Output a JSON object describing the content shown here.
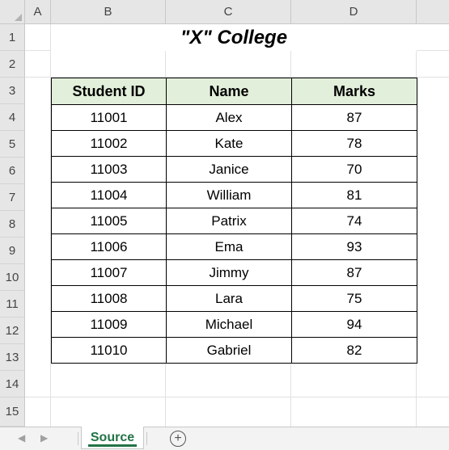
{
  "columns": [
    "A",
    "B",
    "C",
    "D"
  ],
  "rows": [
    "1",
    "2",
    "3",
    "4",
    "5",
    "6",
    "7",
    "8",
    "9",
    "10",
    "11",
    "12",
    "13",
    "14",
    "15"
  ],
  "sheet_title": "\"X\" College",
  "table": {
    "headers": [
      "Student ID",
      "Name",
      "Marks"
    ],
    "rows": [
      [
        "11001",
        "Alex",
        "87"
      ],
      [
        "11002",
        "Kate",
        "78"
      ],
      [
        "11003",
        "Janice",
        "70"
      ],
      [
        "11004",
        "William",
        "81"
      ],
      [
        "11005",
        "Patrix",
        "74"
      ],
      [
        "11006",
        "Ema",
        "93"
      ],
      [
        "11007",
        "Jimmy",
        "87"
      ],
      [
        "11008",
        "Lara",
        "75"
      ],
      [
        "11009",
        "Michael",
        "94"
      ],
      [
        "11010",
        "Gabriel",
        "82"
      ]
    ]
  },
  "tabs": {
    "active": "Source",
    "add_icon": "plus-circle-icon"
  },
  "colors": {
    "header_fill": "#e2efda",
    "tab_accent": "#217346"
  }
}
